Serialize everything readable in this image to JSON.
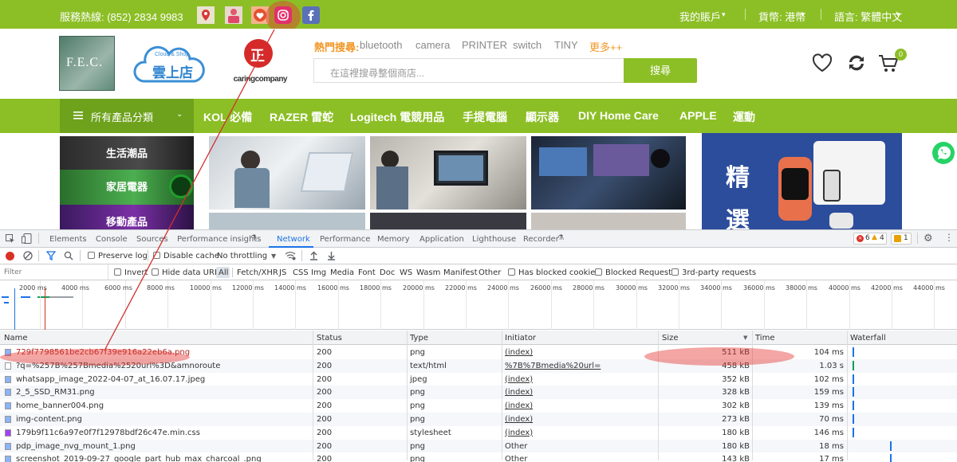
{
  "topbar": {
    "hotline": "服務熱線: (852) 2834 9983",
    "account": "我的賬戶",
    "currency": "貨幣: 港幣",
    "language": "語言: 繁體中文",
    "social_icons": [
      "map-pin-icon",
      "person-icon",
      "wishlist-icon",
      "instagram-icon",
      "facebook-icon"
    ]
  },
  "header": {
    "logo_text": "F.E.C.",
    "cloud_shop_top": "Cloud & Shop",
    "cloud_shop_main": "雲上店",
    "badge_char": "正",
    "caring_company": "caringcompany",
    "hot_label": "熱門搜尋:",
    "hot_keywords": [
      "bluetooth",
      "camera",
      "PRINTER",
      "switch",
      "TINY"
    ],
    "hot_more": "更多++",
    "search_placeholder": "在這裡搜尋整個商店...",
    "search_button": "搜尋",
    "cart_count": "0"
  },
  "nav": {
    "category_label": "所有產品分類",
    "items": [
      "KOL 必備",
      "RAZER 雷蛇",
      "Logitech 電競用品",
      "手提電腦",
      "顯示器",
      "DIY Home Care",
      "APPLE",
      "運動"
    ]
  },
  "content": {
    "categories": [
      "生活潮品",
      "家居電器",
      "移動產品"
    ],
    "promo_text": "精選"
  },
  "devtools": {
    "tabs": [
      "Elements",
      "Console",
      "Sources",
      "Performance insights",
      "Network",
      "Performance",
      "Memory",
      "Application",
      "Lighthouse",
      "Recorder"
    ],
    "active_tab": "Network",
    "errors": "6",
    "warnings": "4",
    "issues": "1",
    "toolbar": {
      "preserve_log": "Preserve log",
      "disable_cache": "Disable cache",
      "throttling": "No throttling"
    },
    "filter": {
      "placeholder": "Filter",
      "invert": "Invert",
      "hide_data_urls": "Hide data URLs",
      "types": [
        "All",
        "Fetch/XHR",
        "JS",
        "CSS",
        "Img",
        "Media",
        "Font",
        "Doc",
        "WS",
        "Wasm",
        "Manifest",
        "Other"
      ],
      "has_blocked_cookies": "Has blocked cookies",
      "blocked_requests": "Blocked Requests",
      "third_party": "3rd-party requests"
    },
    "timeline_ticks": [
      "2000 ms",
      "4000 ms",
      "6000 ms",
      "8000 ms",
      "10000 ms",
      "12000 ms",
      "14000 ms",
      "16000 ms",
      "18000 ms",
      "20000 ms",
      "22000 ms",
      "24000 ms",
      "26000 ms",
      "28000 ms",
      "30000 ms",
      "32000 ms",
      "34000 ms",
      "36000 ms",
      "38000 ms",
      "40000 ms",
      "42000 ms",
      "44000 ms"
    ],
    "columns": [
      "Name",
      "Status",
      "Type",
      "Initiator",
      "Size",
      "Time",
      "Waterfall"
    ],
    "rows": [
      {
        "name": "729f7798561be2cb67f39e916a22eb6a.png",
        "status": "200",
        "type": "png",
        "initiator": "(index)",
        "size": "511 kB",
        "time": "104 ms",
        "icon": "image-file-icon"
      },
      {
        "name": "?q=%257B%257Bmedia%2520url%3D&amnoroute",
        "status": "200",
        "type": "text/html",
        "initiator": "%7B%7Bmedia%20url=",
        "size": "458 kB",
        "time": "1.03 s",
        "icon": "document-file-icon"
      },
      {
        "name": "whatsapp_image_2022-04-07_at_16.07.17.jpeg",
        "status": "200",
        "type": "jpeg",
        "initiator": "(index)",
        "size": "352 kB",
        "time": "102 ms",
        "icon": "image-file-icon"
      },
      {
        "name": "2_5_SSD_RM31.png",
        "status": "200",
        "type": "png",
        "initiator": "(index)",
        "size": "328 kB",
        "time": "159 ms",
        "icon": "image-file-icon"
      },
      {
        "name": "home_banner004.png",
        "status": "200",
        "type": "png",
        "initiator": "(index)",
        "size": "302 kB",
        "time": "139 ms",
        "icon": "image-file-icon"
      },
      {
        "name": "img-content.png",
        "status": "200",
        "type": "png",
        "initiator": "(index)",
        "size": "273 kB",
        "time": "70 ms",
        "icon": "image-file-icon"
      },
      {
        "name": "179b9f11c6a97e0f7f12978bdf26c47e.min.css",
        "status": "200",
        "type": "stylesheet",
        "initiator": "(index)",
        "size": "180 kB",
        "time": "146 ms",
        "icon": "css-file-icon"
      },
      {
        "name": "pdp_image_nvg_mount_1.png",
        "status": "200",
        "type": "png",
        "initiator": "Other",
        "size": "180 kB",
        "time": "18 ms",
        "icon": "image-file-icon"
      },
      {
        "name": "screenshot_2019-09-27_google_part_hub_max_charcoal_.png",
        "status": "200",
        "type": "png",
        "initiator": "Other",
        "size": "143 kB",
        "time": "17 ms",
        "icon": "image-file-icon"
      }
    ]
  },
  "colors": {
    "brand_green": "#8cbf26",
    "nav_dark_green": "#6ea21d",
    "devtools_blue": "#1a73e8",
    "highlight_red": "#e53935"
  }
}
